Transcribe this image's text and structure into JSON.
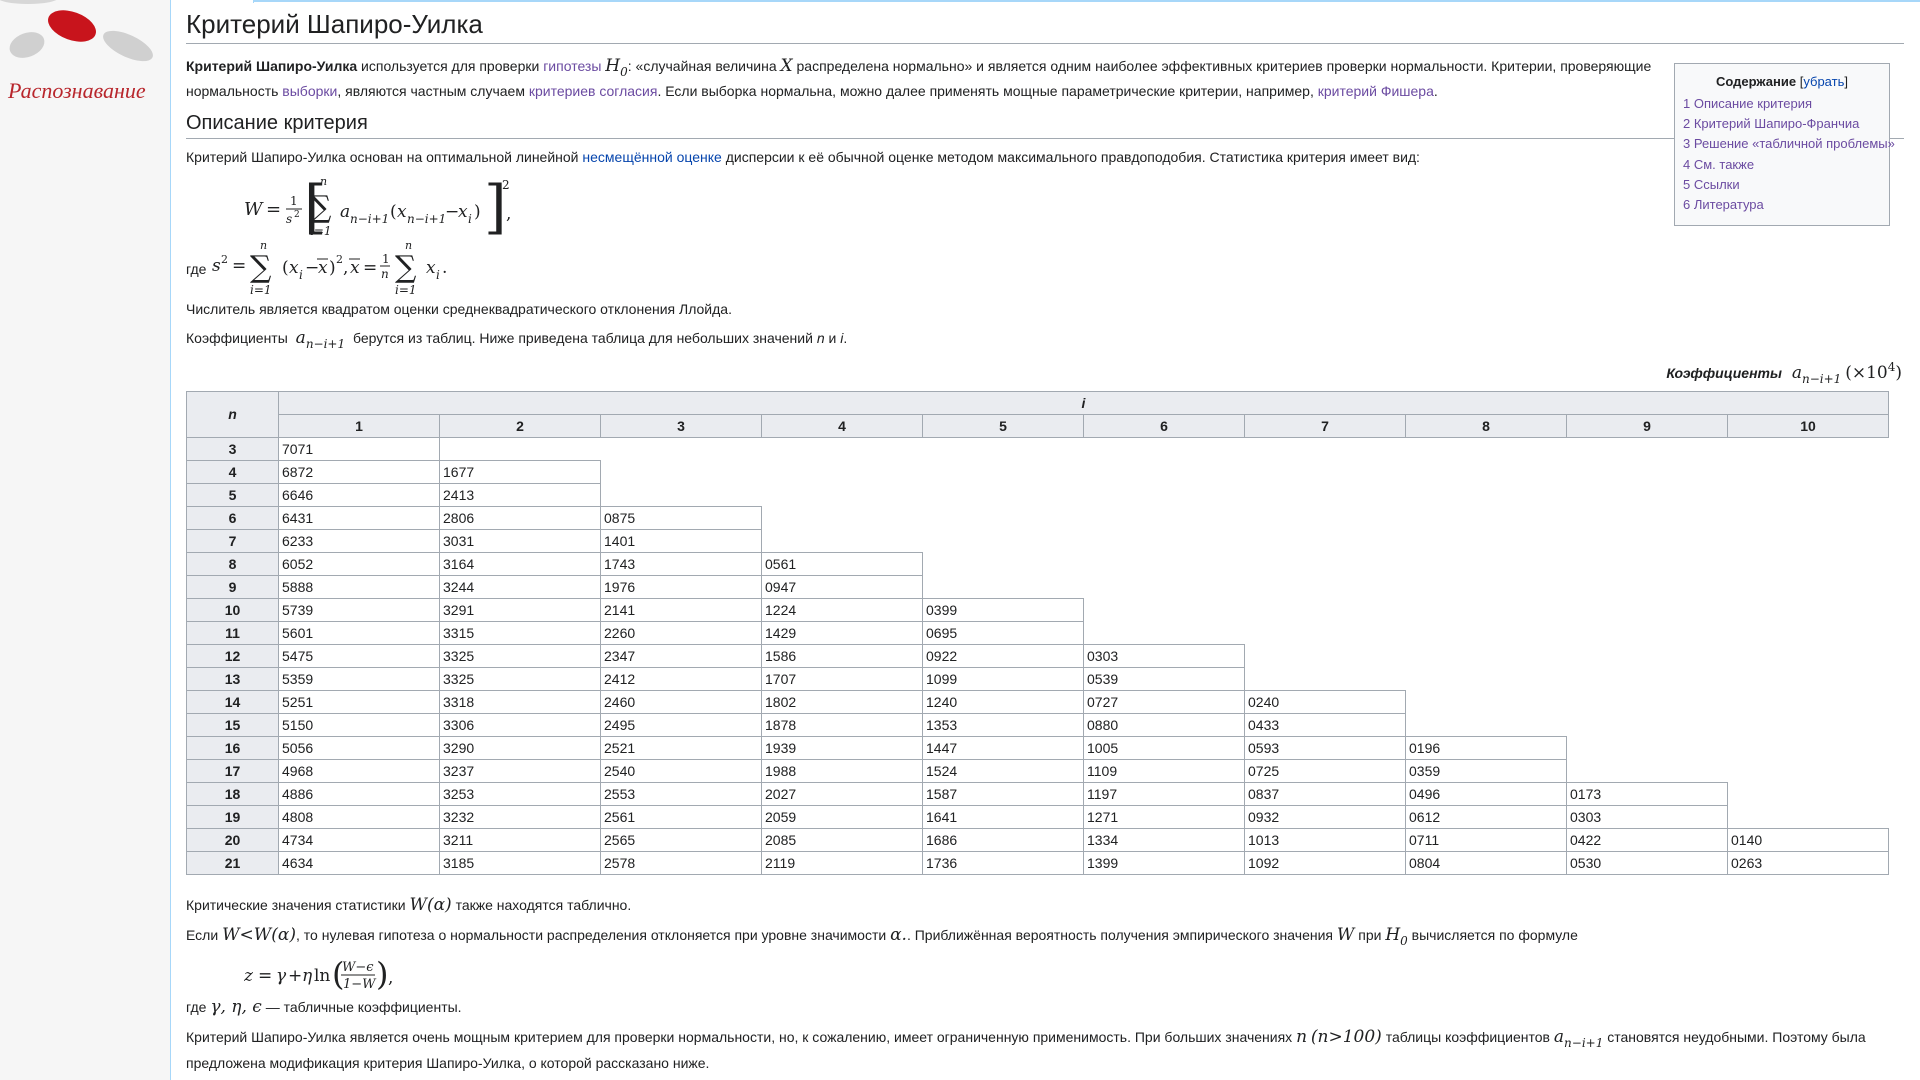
{
  "sidebar": {
    "logo_text": "Распознавание"
  },
  "page": {
    "title": "Критерий Шапиро-Уилка",
    "intro": {
      "bold": "Критерий Шапиро-Уилка",
      "t1": " используется для проверки ",
      "link_hypothesis": "гипотезы",
      "t2": ": «случайная величина ",
      "t3": " распределена нормально» и является одним наиболее эффективных критериев проверки нормальности. Критерии, проверяющие нормальность ",
      "link_samples": "выборки",
      "t4": ", являются частным случаем ",
      "link_goodness": "критериев согласия",
      "t5": ". Если выборка нормальна, можно далее применять мощные параметрические критерии, например, ",
      "link_fisher": "критерий Фишера",
      "t6": "."
    },
    "section1": {
      "heading": "Описание критерия",
      "p1_a": "Критерий Шапиро-Уилка основан на оптимальной линейной ",
      "p1_link": "несмещённой оценке",
      "p1_b": " дисперсии к её обычной оценке методом максимального правдоподобия. Статистика критерия имеет вид:",
      "where": "где",
      "p_numerator": "Числитель является квадратом оценки среднеквадратического отклонения Ллойда.",
      "p_coef_a": "Коэффициенты",
      "p_coef_b": " берутся из таблиц. Ниже приведена таблица для небольших значений ",
      "p_coef_n": "n",
      "p_coef_and": " и ",
      "p_coef_i": "i",
      "p_coef_end": "."
    },
    "toc": {
      "title": "Содержание",
      "toggle": "убрать",
      "items": [
        "1 Описание критерия",
        "2 Критерий Шапиро-Франчиа",
        "3 Решение «табличной проблемы»",
        "4 См. также",
        "5 Ссылки",
        "6 Литература"
      ]
    },
    "table": {
      "caption": "Коэффициенты",
      "caption_scale": "(×10",
      "caption_exp": "4",
      "n_header": "n",
      "i_header": "i",
      "columns": [
        "1",
        "2",
        "3",
        "4",
        "5",
        "6",
        "7",
        "8",
        "9",
        "10"
      ],
      "rows": [
        {
          "n": "3",
          "v": [
            "7071"
          ]
        },
        {
          "n": "4",
          "v": [
            "6872",
            "1677"
          ]
        },
        {
          "n": "5",
          "v": [
            "6646",
            "2413"
          ]
        },
        {
          "n": "6",
          "v": [
            "6431",
            "2806",
            "0875"
          ]
        },
        {
          "n": "7",
          "v": [
            "6233",
            "3031",
            "1401"
          ]
        },
        {
          "n": "8",
          "v": [
            "6052",
            "3164",
            "1743",
            "0561"
          ]
        },
        {
          "n": "9",
          "v": [
            "5888",
            "3244",
            "1976",
            "0947"
          ]
        },
        {
          "n": "10",
          "v": [
            "5739",
            "3291",
            "2141",
            "1224",
            "0399"
          ]
        },
        {
          "n": "11",
          "v": [
            "5601",
            "3315",
            "2260",
            "1429",
            "0695"
          ]
        },
        {
          "n": "12",
          "v": [
            "5475",
            "3325",
            "2347",
            "1586",
            "0922",
            "0303"
          ]
        },
        {
          "n": "13",
          "v": [
            "5359",
            "3325",
            "2412",
            "1707",
            "1099",
            "0539"
          ]
        },
        {
          "n": "14",
          "v": [
            "5251",
            "3318",
            "2460",
            "1802",
            "1240",
            "0727",
            "0240"
          ]
        },
        {
          "n": "15",
          "v": [
            "5150",
            "3306",
            "2495",
            "1878",
            "1353",
            "0880",
            "0433"
          ]
        },
        {
          "n": "16",
          "v": [
            "5056",
            "3290",
            "2521",
            "1939",
            "1447",
            "1005",
            "0593",
            "0196"
          ]
        },
        {
          "n": "17",
          "v": [
            "4968",
            "3237",
            "2540",
            "1988",
            "1524",
            "1109",
            "0725",
            "0359"
          ]
        },
        {
          "n": "18",
          "v": [
            "4886",
            "3253",
            "2553",
            "2027",
            "1587",
            "1197",
            "0837",
            "0496",
            "0173"
          ]
        },
        {
          "n": "19",
          "v": [
            "4808",
            "3232",
            "2561",
            "2059",
            "1641",
            "1271",
            "0932",
            "0612",
            "0303"
          ]
        },
        {
          "n": "20",
          "v": [
            "4734",
            "3211",
            "2565",
            "2085",
            "1686",
            "1334",
            "1013",
            "0711",
            "0422",
            "0140"
          ]
        },
        {
          "n": "21",
          "v": [
            "4634",
            "3185",
            "2578",
            "2119",
            "1736",
            "1399",
            "1092",
            "0804",
            "0530",
            "0263"
          ]
        }
      ]
    },
    "after_table": {
      "crit_a": "Критические значения статистики ",
      "crit_b": " также находятся таблично.",
      "if_a": "Если ",
      "if_b": ", то нулевая гипотеза о нормальности распределения отклоняется при уровне значимости ",
      "if_c": ". Приближённая вероятность получения эмпирического значения ",
      "if_d": " при ",
      "if_e": " вычисляется по формуле",
      "where2_a": "где ",
      "where2_b": " — табличные коэффициенты.",
      "last_a": "Критерий Шапиро-Уилка является очень мощным критерием для проверки нормальности, но, к сожалению, имеет ограниченную применимость. При больших значениях ",
      "last_b": " таблицы коэффициентов ",
      "last_c": " становятся неудобными. Поэтому была предложена модификация критерия Шапиро-Уилка, о которой рассказано ниже."
    }
  },
  "colors": {
    "link": "#0645ad",
    "visited": "#6b4ba1",
    "border": "#a2a9b1",
    "header_bg": "#eaecf0",
    "logo_red": "#b8262c"
  }
}
